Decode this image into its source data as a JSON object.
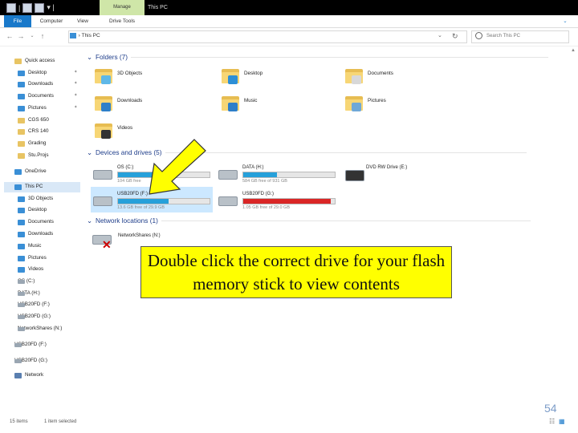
{
  "window": {
    "context_tab": "Manage",
    "title": "This PC"
  },
  "ribbon": {
    "tabs": [
      "File",
      "Computer",
      "View",
      "Drive Tools"
    ]
  },
  "nav": {
    "address": "This PC",
    "search_placeholder": "Search This PC"
  },
  "nav_pane": {
    "items": [
      {
        "label": "Quick access",
        "icon": "star-icon",
        "pinned": false
      },
      {
        "label": "Desktop",
        "icon": "desktop-icon",
        "pinned": true
      },
      {
        "label": "Downloads",
        "icon": "download-icon",
        "pinned": true
      },
      {
        "label": "Documents",
        "icon": "documents-icon",
        "pinned": true
      },
      {
        "label": "Pictures",
        "icon": "pictures-icon",
        "pinned": true
      },
      {
        "label": "CGS 650",
        "icon": "folder-icon",
        "pinned": false
      },
      {
        "label": "CRS 140",
        "icon": "folder-icon",
        "pinned": false
      },
      {
        "label": "Grading",
        "icon": "folder-icon",
        "pinned": false
      },
      {
        "label": "Stu.Projs",
        "icon": "folder-icon",
        "pinned": false
      },
      {
        "label": "OneDrive",
        "icon": "cloud-icon",
        "pinned": false
      },
      {
        "label": "This PC",
        "icon": "computer-icon",
        "pinned": false
      },
      {
        "label": "3D Objects",
        "icon": "cube-icon",
        "pinned": false
      },
      {
        "label": "Desktop",
        "icon": "desktop-icon",
        "pinned": false
      },
      {
        "label": "Documents",
        "icon": "documents-icon",
        "pinned": false
      },
      {
        "label": "Downloads",
        "icon": "download-icon",
        "pinned": false
      },
      {
        "label": "Music",
        "icon": "music-icon",
        "pinned": false
      },
      {
        "label": "Pictures",
        "icon": "pictures-icon",
        "pinned": false
      },
      {
        "label": "Videos",
        "icon": "videos-icon",
        "pinned": false
      },
      {
        "label": "OS (C:)",
        "icon": "drive-icon",
        "pinned": false
      },
      {
        "label": "DATA (H:)",
        "icon": "drive-icon",
        "pinned": false
      },
      {
        "label": "USB20FD (F:)",
        "icon": "usb-drive-icon",
        "pinned": false
      },
      {
        "label": "USB20FD (G:)",
        "icon": "usb-drive-icon",
        "pinned": false
      },
      {
        "label": "NetworkShares (N:)",
        "icon": "network-drive-icon",
        "pinned": false
      },
      {
        "label": "USB20FD (F:)",
        "icon": "usb-drive-icon",
        "pinned": false
      },
      {
        "label": "USB20FD (G:)",
        "icon": "usb-drive-icon",
        "pinned": false
      },
      {
        "label": "Network",
        "icon": "network-icon",
        "pinned": false
      }
    ]
  },
  "content": {
    "folders_header": "Folders (7)",
    "folders": [
      {
        "name": "3D Objects",
        "badge": "cube-icon",
        "color": "#5fb8e8"
      },
      {
        "name": "Desktop",
        "badge": "desktop-icon",
        "color": "#2d8fd6"
      },
      {
        "name": "Documents",
        "badge": "documents-icon",
        "color": "#d8d8d8"
      },
      {
        "name": "Downloads",
        "badge": "download-icon",
        "color": "#2d7fc9"
      },
      {
        "name": "Music",
        "badge": "music-icon",
        "color": "#2d7fc9"
      },
      {
        "name": "Pictures",
        "badge": "pictures-icon",
        "color": "#6fa8d8"
      },
      {
        "name": "Videos",
        "badge": "videos-icon",
        "color": "#333333"
      }
    ],
    "devices_header": "Devices and drives (5)",
    "drives": [
      {
        "name": "OS (C:)",
        "free": "104 GB free",
        "fill_pct": 55,
        "color": "#26a0da"
      },
      {
        "name": "DATA (H:)",
        "free": "584 GB free of 931 GB",
        "fill_pct": 37,
        "color": "#26a0da"
      },
      {
        "name": "DVD RW Drive (E:)",
        "free": "",
        "fill_pct": 0,
        "color": "#26a0da"
      },
      {
        "name": "USB20FD (F:)",
        "free": "13.6 GB free of 29.9 GB",
        "fill_pct": 55,
        "color": "#26a0da"
      },
      {
        "name": "USB20FD (G:)",
        "free": "1.05 GB free of 29.0 GB",
        "fill_pct": 96,
        "color": "#da2626"
      }
    ],
    "network_header": "Network locations (1)",
    "network": [
      {
        "name": "NetworkShares (N:)"
      }
    ]
  },
  "status": {
    "items": "15 items",
    "selected": "1 item selected"
  },
  "annotation": {
    "text": "Double click the correct drive for your flash memory stick to view contents"
  },
  "slide_number": "54",
  "colors": {
    "accent": "#1979ca",
    "callout": "#ffff00",
    "selection": "#cce8ff",
    "low_space": "#da2626"
  }
}
